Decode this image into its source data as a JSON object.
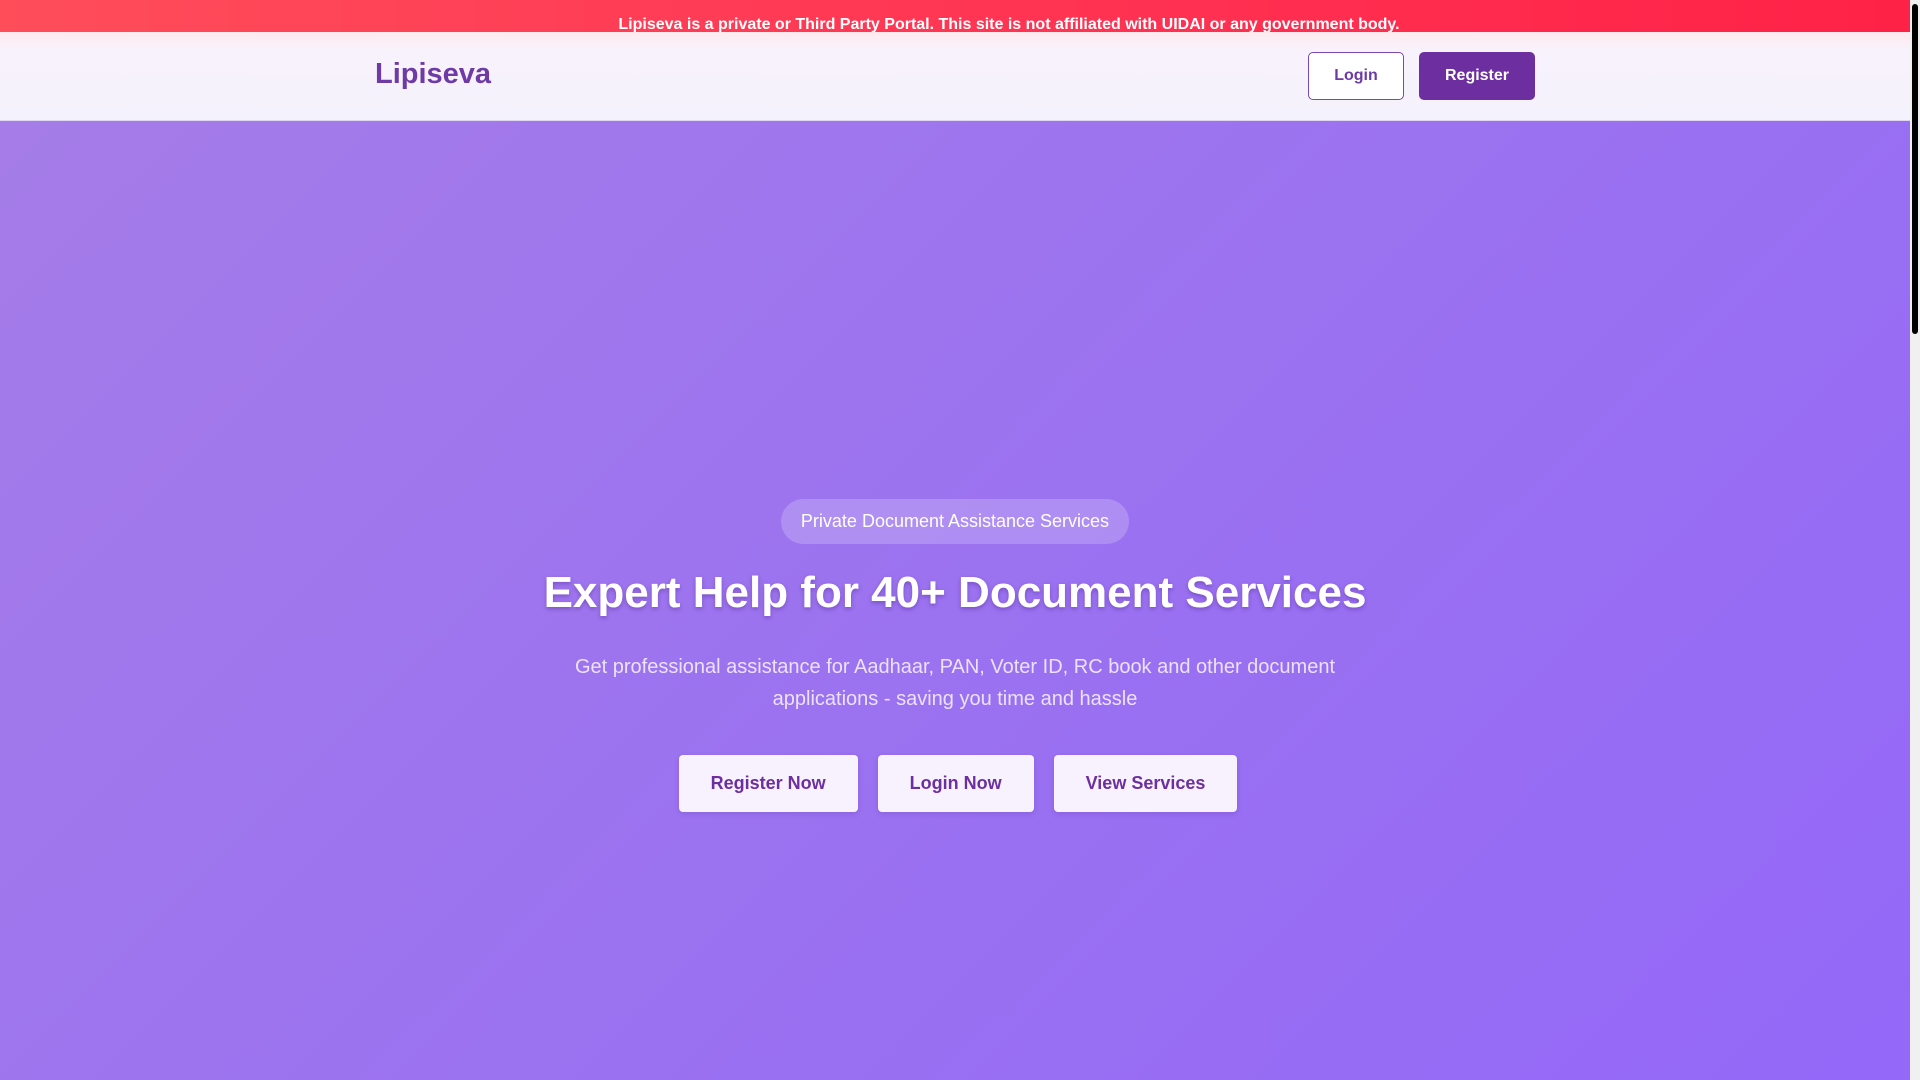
{
  "disclaimer": {
    "text": "Lipiseva is a private or Third Party Portal. This site is not affiliated with UIDAI or any government body."
  },
  "header": {
    "brand": "Lipiseva",
    "login_label": "Login",
    "register_label": "Register"
  },
  "hero": {
    "badge": "Private Document Assistance Services",
    "title": "Expert Help for 40+ Document Services",
    "subtitle": "Get professional assistance for Aadhaar, PAN, Voter ID, RC book and other document applications - saving you time and hassle",
    "actions": {
      "register_now": "Register Now",
      "login_now": "Login Now",
      "view_services": "View Services"
    }
  },
  "colors": {
    "disclaimer_bg": "#ff3152",
    "brand": "#6e3aa6",
    "primary": "#6d2f9f",
    "hero_bg": "#9b72f0"
  }
}
